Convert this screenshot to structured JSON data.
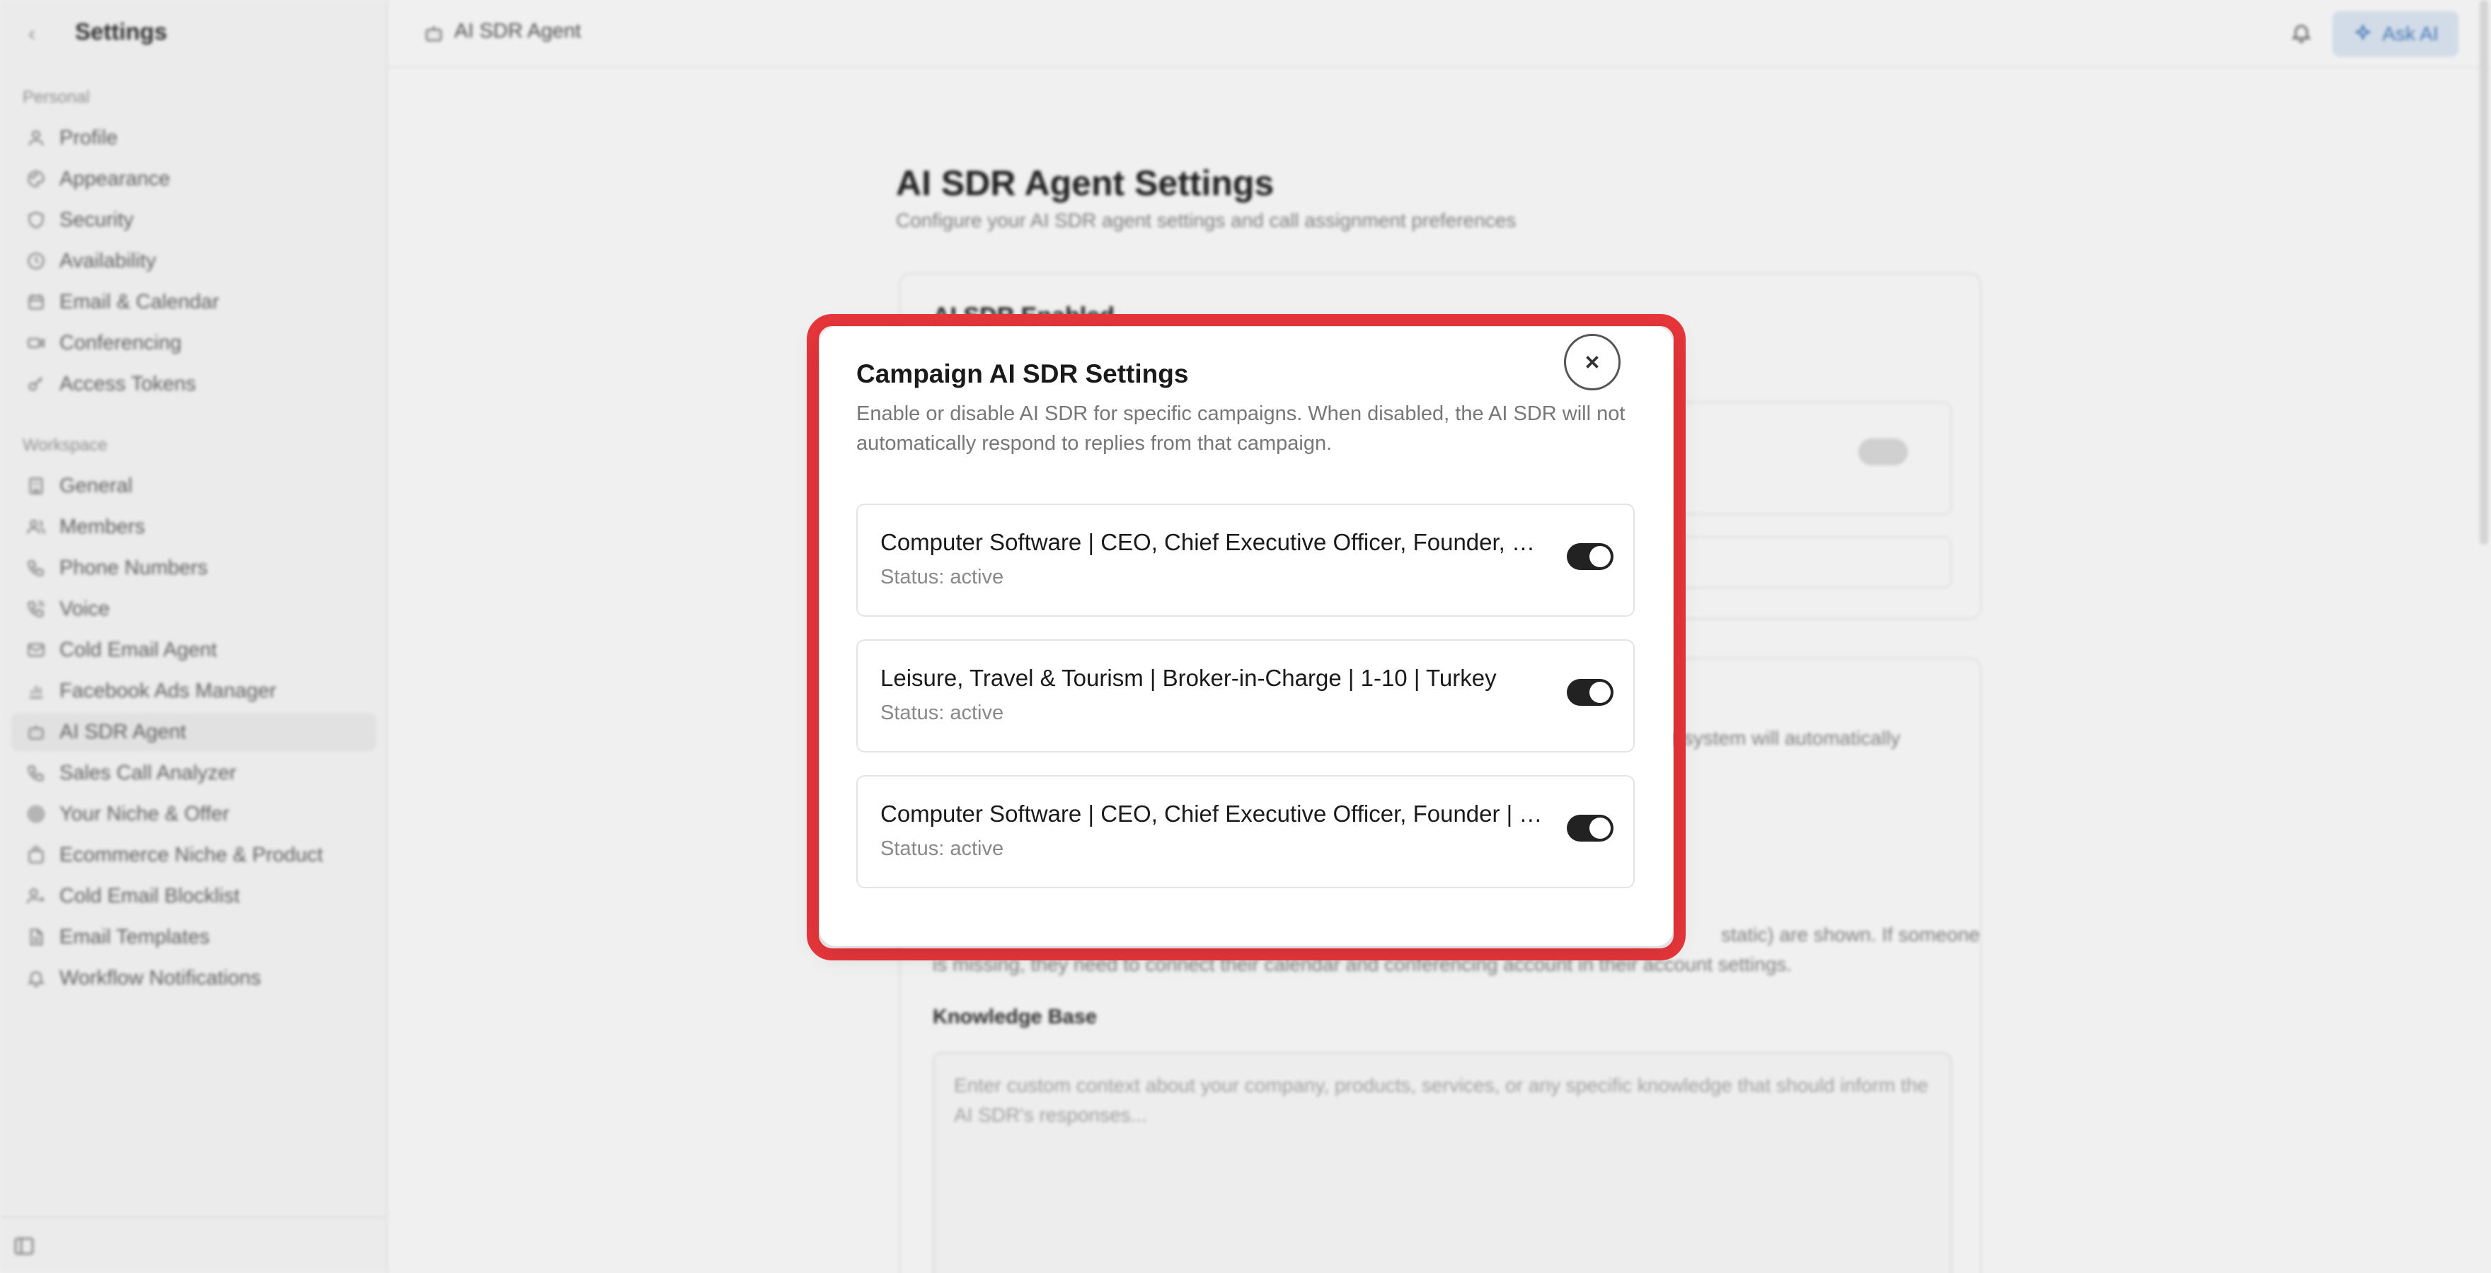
{
  "sidebar": {
    "title": "Settings",
    "personal_label": "Personal",
    "workspace_label": "Workspace",
    "personal_items": [
      {
        "label": "Profile",
        "icon": "user-icon"
      },
      {
        "label": "Appearance",
        "icon": "palette-icon"
      },
      {
        "label": "Security",
        "icon": "shield-icon"
      },
      {
        "label": "Availability",
        "icon": "clock-icon"
      },
      {
        "label": "Email & Calendar",
        "icon": "calendar-icon"
      },
      {
        "label": "Conferencing",
        "icon": "video-icon"
      },
      {
        "label": "Access Tokens",
        "icon": "key-icon"
      }
    ],
    "workspace_items": [
      {
        "label": "General",
        "icon": "building-icon"
      },
      {
        "label": "Members",
        "icon": "users-icon"
      },
      {
        "label": "Phone Numbers",
        "icon": "phone-icon"
      },
      {
        "label": "Voice",
        "icon": "phone-call-icon"
      },
      {
        "label": "Cold Email Agent",
        "icon": "mail-icon"
      },
      {
        "label": "Facebook Ads Manager",
        "icon": "bar-chart-icon"
      },
      {
        "label": "AI SDR Agent",
        "icon": "bot-icon"
      },
      {
        "label": "Sales Call Analyzer",
        "icon": "phone-analyze-icon"
      },
      {
        "label": "Your Niche & Offer",
        "icon": "target-icon"
      },
      {
        "label": "Ecommerce Niche & Product",
        "icon": "shopping-bag-icon"
      },
      {
        "label": "Cold Email Blocklist",
        "icon": "user-x-icon"
      },
      {
        "label": "Email Templates",
        "icon": "file-text-icon"
      },
      {
        "label": "Workflow Notifications",
        "icon": "bell-icon"
      }
    ]
  },
  "topbar": {
    "breadcrumb": "AI SDR Agent",
    "ask_ai": "Ask AI"
  },
  "main": {
    "title": "AI SDR Agent Settings",
    "subtitle": "Configure your AI SDR agent settings and call assignment preferences",
    "card1_heading": "AI SDR Enabled",
    "bg_fragment_1": "the system will automatically",
    "bg_fragment_2": "static) are shown. If someone",
    "bg_fragment_3": "is missing, they need to connect their calendar and conferencing account in their account settings.",
    "kb_label": "Knowledge Base",
    "kb_placeholder": "Enter custom context about your company, products, services, or any specific knowledge that should inform the AI SDR's responses..."
  },
  "modal": {
    "title": "Campaign AI SDR Settings",
    "description": "Enable or disable AI SDR for specific campaigns. When disabled, the AI SDR will not automatically respond to replies from that campaign.",
    "campaigns": [
      {
        "name": "Computer Software | CEO, Chief Executive Officer, Founder, Co-...",
        "status": "Status: active",
        "enabled": true
      },
      {
        "name": "Leisure, Travel & Tourism | Broker-in-Charge | 1-10 | Turkey",
        "status": "Status: active",
        "enabled": true
      },
      {
        "name": "Computer Software | CEO, Chief Executive Officer, Founder | Can...",
        "status": "Status: active",
        "enabled": true
      }
    ]
  },
  "colors": {
    "highlight": "#e8363b",
    "toggle_on": "#222222",
    "ask_ai_bg": "#dfeaf7",
    "ask_ai_text": "#4a7fc1"
  }
}
